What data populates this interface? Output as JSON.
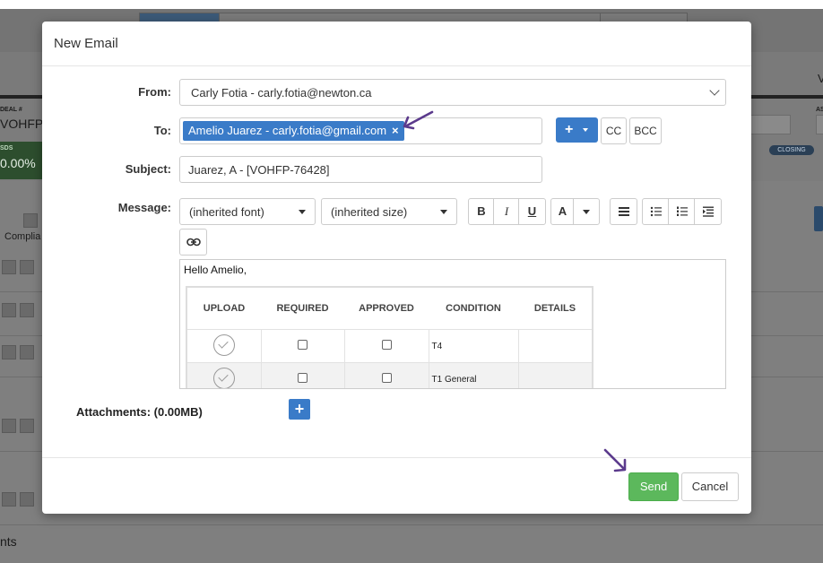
{
  "background": {
    "deal_label": "DEAL #",
    "deal_value": "VOHFP-7",
    "amount_label": "SDS",
    "amount_value": "0.00%",
    "closing_badge": "CLOSING",
    "compliance_label": "Complia",
    "bottom_text": "nts",
    "right_label": "V",
    "right_small": "AS"
  },
  "modal": {
    "title": "New Email",
    "from_label": "From:",
    "from_value": "Carly Fotia - carly.fotia@newton.ca",
    "to_label": "To:",
    "to_chip": "Amelio Juarez - carly.fotia@gmail.com",
    "to_chip_remove": "×",
    "add_recipient": "+",
    "cc_label": "CC",
    "bcc_label": "BCC",
    "subject_label": "Subject:",
    "subject_value": "Juarez, A - [VOHFP-76428]",
    "message_label": "Message:",
    "font_select": "(inherited font)",
    "size_select": "(inherited size)",
    "bold": "B",
    "italic": "I",
    "underline": "U",
    "font_color": "A",
    "greeting": "Hello Amelio,",
    "table": {
      "headers": [
        "UPLOAD",
        "REQUIRED",
        "APPROVED",
        "CONDITION",
        "DETAILS"
      ],
      "rows": [
        {
          "condition": "T4",
          "details": ""
        },
        {
          "condition": "T1 General",
          "details": ""
        }
      ]
    },
    "attachments_label": "Attachments: (0.00MB)",
    "attach_add": "+",
    "send": "Send",
    "cancel": "Cancel"
  },
  "colors": {
    "primary": "#3a7bc8",
    "success": "#5cb85c",
    "annotation_arrow": "#5b3a8c"
  }
}
